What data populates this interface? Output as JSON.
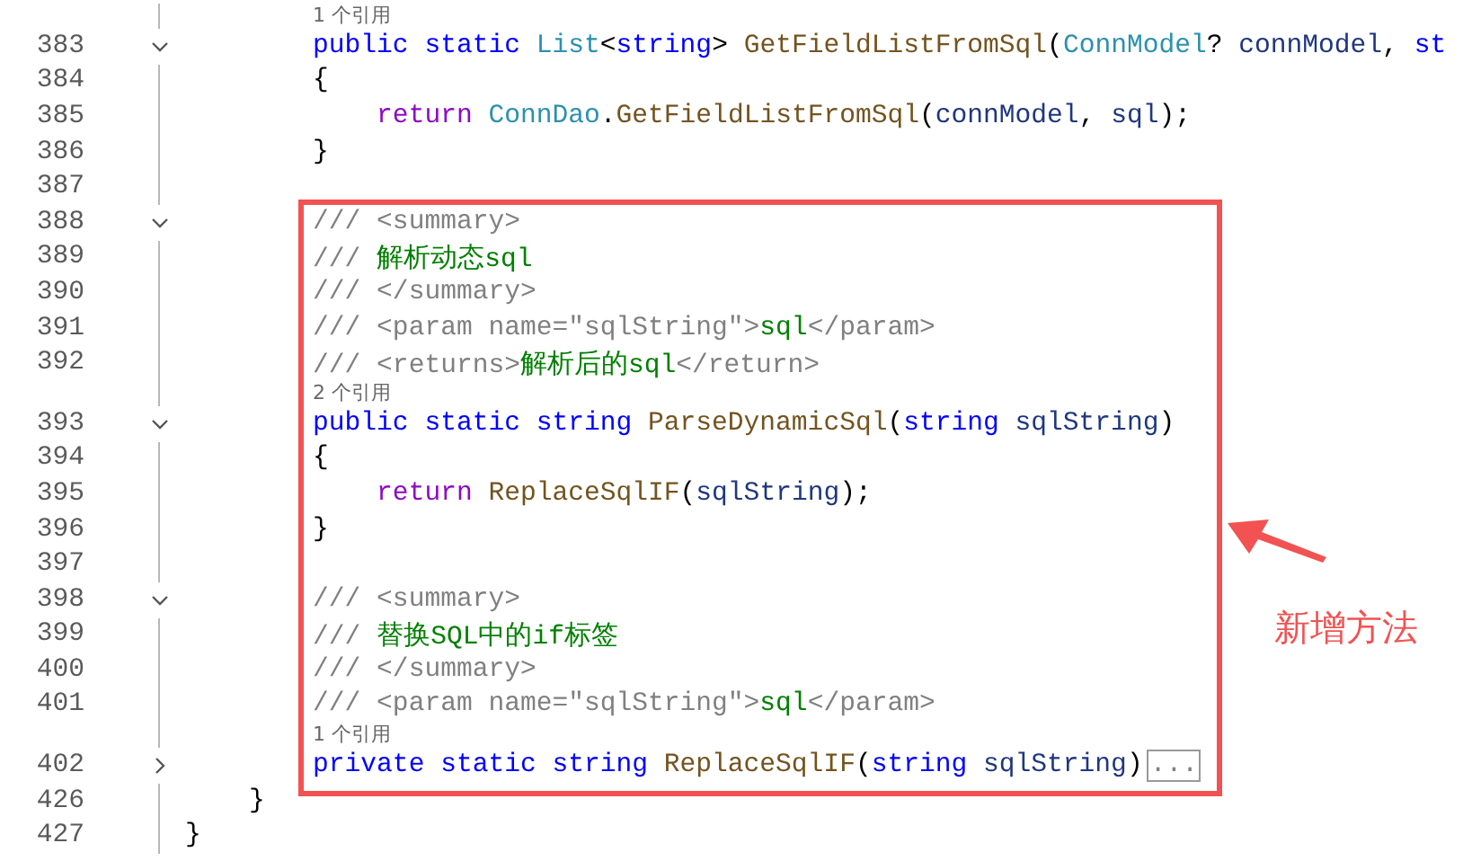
{
  "editor": {
    "sections": [
      {
        "kind": "plain",
        "lines": [
          {
            "kind": "lens",
            "text": "1 个引用"
          },
          {
            "kind": "code",
            "number": "383",
            "expanded": true,
            "tokens": [
              {
                "kind": "kw",
                "text": "        public static "
              },
              {
                "kind": "type",
                "text": "List"
              },
              {
                "kind": "plain",
                "text": "<"
              },
              {
                "kind": "kw",
                "text": "string"
              },
              {
                "kind": "plain",
                "text": "> "
              },
              {
                "kind": "method",
                "text": "GetFieldListFromSql"
              },
              {
                "kind": "plain",
                "text": "("
              },
              {
                "kind": "type",
                "text": "ConnModel"
              },
              {
                "kind": "plain",
                "text": "? "
              },
              {
                "kind": "param",
                "text": "connModel"
              },
              {
                "kind": "plain",
                "text": ", "
              },
              {
                "kind": "kw",
                "text": "st"
              }
            ]
          },
          {
            "kind": "code",
            "number": "384",
            "tokens": [
              {
                "kind": "plain",
                "text": "        {"
              }
            ]
          },
          {
            "kind": "code",
            "number": "385",
            "tokens": [
              {
                "kind": "ctrl",
                "text": "            return "
              },
              {
                "kind": "type",
                "text": "ConnDao"
              },
              {
                "kind": "plain",
                "text": "."
              },
              {
                "kind": "method",
                "text": "GetFieldListFromSql"
              },
              {
                "kind": "plain",
                "text": "("
              },
              {
                "kind": "param",
                "text": "connModel"
              },
              {
                "kind": "plain",
                "text": ", "
              },
              {
                "kind": "param",
                "text": "sql"
              },
              {
                "kind": "plain",
                "text": ");"
              }
            ]
          },
          {
            "kind": "code",
            "number": "386",
            "tokens": [
              {
                "kind": "plain",
                "text": "        }"
              }
            ]
          },
          {
            "kind": "code",
            "number": "387"
          }
        ]
      },
      {
        "kind": "highlight",
        "lines": [
          {
            "kind": "code",
            "number": "388",
            "expanded": true,
            "tokens": [
              {
                "kind": "doc",
                "text": "        /// <summary>"
              }
            ]
          },
          {
            "kind": "code",
            "number": "389",
            "tokens": [
              {
                "kind": "doc",
                "text": "        /// "
              },
              {
                "kind": "doctext",
                "text": "解析动态sql"
              }
            ]
          },
          {
            "kind": "code",
            "number": "390",
            "tokens": [
              {
                "kind": "doc",
                "text": "        /// </summary>"
              }
            ]
          },
          {
            "kind": "code",
            "number": "391",
            "tokens": [
              {
                "kind": "doc",
                "text": "        /// <param name=\"sqlString\">"
              },
              {
                "kind": "doctext",
                "text": "sql"
              },
              {
                "kind": "doc",
                "text": "</param>"
              }
            ]
          },
          {
            "kind": "code",
            "number": "392",
            "tokens": [
              {
                "kind": "doc",
                "text": "        /// <returns>"
              },
              {
                "kind": "doctext",
                "text": "解析后的sql"
              },
              {
                "kind": "doc",
                "text": "</return>"
              }
            ]
          },
          {
            "kind": "lens",
            "text": "2 个引用"
          },
          {
            "kind": "code",
            "number": "393",
            "expanded": true,
            "tokens": [
              {
                "kind": "kw",
                "text": "        public static string "
              },
              {
                "kind": "method",
                "text": "ParseDynamicSql"
              },
              {
                "kind": "plain",
                "text": "("
              },
              {
                "kind": "kw",
                "text": "string "
              },
              {
                "kind": "param",
                "text": "sqlString"
              },
              {
                "kind": "plain",
                "text": ")"
              }
            ]
          },
          {
            "kind": "code",
            "number": "394",
            "tokens": [
              {
                "kind": "plain",
                "text": "        {"
              }
            ]
          },
          {
            "kind": "code",
            "number": "395",
            "tokens": [
              {
                "kind": "ctrl",
                "text": "            return "
              },
              {
                "kind": "method",
                "text": "ReplaceSqlIF"
              },
              {
                "kind": "plain",
                "text": "("
              },
              {
                "kind": "param",
                "text": "sqlString"
              },
              {
                "kind": "plain",
                "text": ");"
              }
            ]
          },
          {
            "kind": "code",
            "number": "396",
            "tokens": [
              {
                "kind": "plain",
                "text": "        }"
              }
            ]
          },
          {
            "kind": "code",
            "number": "397"
          },
          {
            "kind": "code",
            "number": "398",
            "expanded": true,
            "tokens": [
              {
                "kind": "doc",
                "text": "        /// <summary>"
              }
            ]
          },
          {
            "kind": "code",
            "number": "399",
            "tokens": [
              {
                "kind": "doc",
                "text": "        /// "
              },
              {
                "kind": "doctext",
                "text": "替换SQL中的if标签"
              }
            ]
          },
          {
            "kind": "code",
            "number": "400",
            "tokens": [
              {
                "kind": "doc",
                "text": "        /// </summary>"
              }
            ]
          },
          {
            "kind": "code",
            "number": "401",
            "tokens": [
              {
                "kind": "doc",
                "text": "        /// <param name=\"sqlString\">"
              },
              {
                "kind": "doctext",
                "text": "sql"
              },
              {
                "kind": "doc",
                "text": "</param>"
              }
            ]
          },
          {
            "kind": "lens",
            "text": "1 个引用"
          },
          {
            "kind": "code",
            "number": "402",
            "expanded": false,
            "tokens": [
              {
                "kind": "kw",
                "text": "        private static string "
              },
              {
                "kind": "method",
                "text": "ReplaceSqlIF"
              },
              {
                "kind": "plain",
                "text": "("
              },
              {
                "kind": "kw",
                "text": "string "
              },
              {
                "kind": "param",
                "text": "sqlString"
              },
              {
                "kind": "plain",
                "text": ")"
              },
              {
                "kind": "more",
                "text": "..."
              }
            ]
          }
        ]
      },
      {
        "kind": "plain",
        "lines": [
          {
            "kind": "code",
            "number": "426",
            "tokens": [
              {
                "kind": "plain",
                "text": "    }"
              }
            ]
          },
          {
            "kind": "code",
            "number": "427",
            "tokens": [
              {
                "kind": "plain",
                "text": "}"
              }
            ]
          }
        ]
      }
    ]
  },
  "annotation": {
    "label": "新增方法"
  }
}
